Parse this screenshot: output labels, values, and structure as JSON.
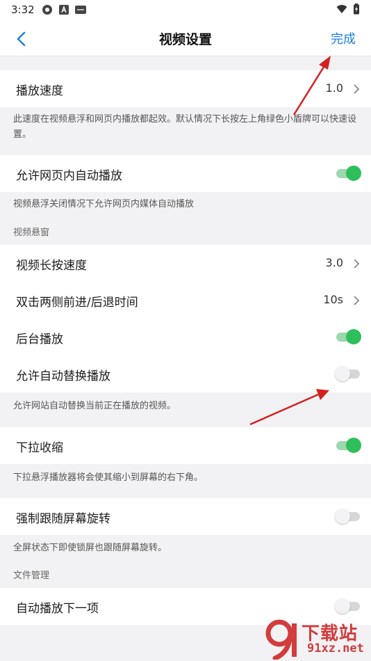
{
  "status": {
    "time": "3:32"
  },
  "nav": {
    "title": "视频设置",
    "done": "完成"
  },
  "rows": {
    "speed": {
      "label": "播放速度",
      "value": "1.0"
    },
    "autoplay_web": {
      "label": "允许网页内自动播放",
      "on": true
    },
    "long_press": {
      "label": "视频长按速度",
      "value": "3.0"
    },
    "double_tap": {
      "label": "双击两侧前进/后退时间",
      "value": "10s"
    },
    "background": {
      "label": "后台播放",
      "on": true
    },
    "auto_replace": {
      "label": "允许自动替换播放",
      "on": false
    },
    "pull_shrink": {
      "label": "下拉收缩",
      "on": true
    },
    "force_rotate": {
      "label": "强制跟随屏幕旋转",
      "on": false
    },
    "autoplay_next": {
      "label": "自动播放下一项",
      "on": false
    }
  },
  "notes": {
    "speed": "此速度在视频悬浮和网页内播放都起效。默认情况下长按左上角绿色小盾牌可以快速设置。",
    "autoplay_web": "视频悬浮关闭情况下允许网页内媒体自动播放",
    "auto_replace": "允许网站自动替换当前正在播放的视频。",
    "pull_shrink": "下拉悬浮播放器将会使其缩小到屏幕的右下角。",
    "force_rotate": "全屏状态下即使锁屏也跟随屏幕旋转。"
  },
  "sections": {
    "video_float": "视频悬窗",
    "file_mgmt": "文件管理"
  },
  "watermark": {
    "top": "下载站",
    "bottom": "91xz.net"
  },
  "colors": {
    "accent": "#1f7fe0",
    "toggle_on": "#2fbf5a",
    "annotation_arrow": "#d42020"
  }
}
